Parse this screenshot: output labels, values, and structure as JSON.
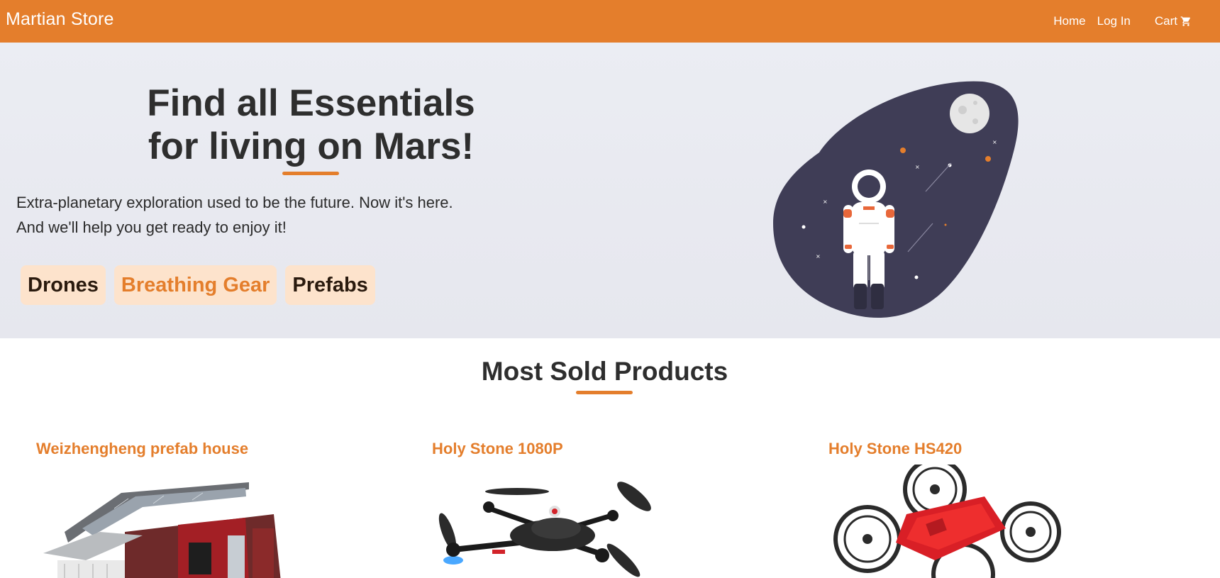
{
  "nav": {
    "brand": "Martian Store",
    "home": "Home",
    "login": "Log In",
    "cart": "Cart",
    "cart_icon": "shopping-cart-icon"
  },
  "hero": {
    "title_line1": "Find all Essentials",
    "title_line2": "for living on Mars!",
    "subtitle_line1": "Extra-planetary exploration used to be the future. Now it's here.",
    "subtitle_line2": "And we'll help you get ready to enjoy it!",
    "categories": [
      {
        "label": "Drones",
        "active": false
      },
      {
        "label": "Breathing Gear",
        "active": true
      },
      {
        "label": "Prefabs",
        "active": false
      }
    ],
    "illustration": "astronaut-in-space-illustration"
  },
  "section": {
    "title": "Most Sold Products"
  },
  "products": [
    {
      "name": "Weizhengheng prefab house",
      "image": "prefab-house-image"
    },
    {
      "name": "Holy Stone 1080P",
      "image": "black-drone-image"
    },
    {
      "name": "Holy Stone HS420",
      "image": "red-mini-drone-image"
    }
  ],
  "colors": {
    "accent": "#e47e2c",
    "category_bg": "#fde3cc",
    "hero_bg": "#e9eaf0",
    "blob": "#3f3d56"
  }
}
